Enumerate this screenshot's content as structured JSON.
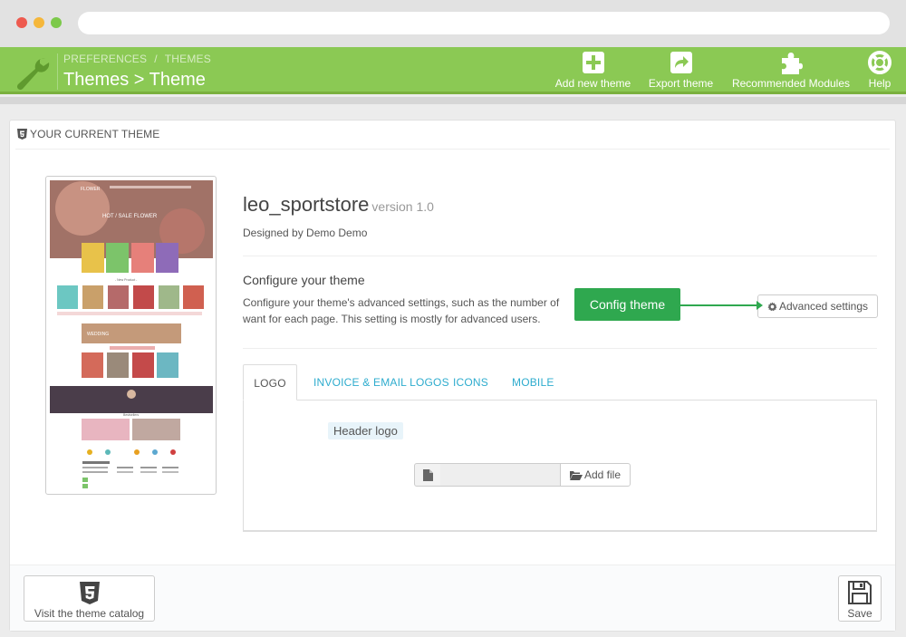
{
  "header": {
    "breadcrumb": [
      "PREFERENCES",
      "THEMES"
    ],
    "breadcrumb_sep": "/",
    "title": "Themes > Theme",
    "toolbar": [
      {
        "label": "Add new theme",
        "icon": "plus-square-icon"
      },
      {
        "label": "Export theme",
        "icon": "export-icon"
      },
      {
        "label": "Recommended Modules",
        "icon": "puzzle-icon"
      },
      {
        "label": "Help",
        "icon": "lifebuoy-icon"
      }
    ]
  },
  "panel": {
    "heading": "YOUR CURRENT THEME",
    "heading_icon": "html5-icon"
  },
  "theme": {
    "name": "leo_sportstore",
    "version": "version 1.0",
    "designed_by": "Designed by Demo Demo",
    "preview": {
      "logo": "FLOWER",
      "banner": "HOT / SALE FLOWER",
      "section_1": "- New Product -",
      "section_2": "WEDDING",
      "section_3": "Bestsellers"
    }
  },
  "configure": {
    "title": "Configure your theme",
    "description_line1": "Configure your theme's advanced settings, such as the number of",
    "description_line2": "want for each page. This setting is mostly for advanced users.",
    "callout": "Config theme",
    "advanced_button": "Advanced settings"
  },
  "tabs": [
    {
      "label": "LOGO",
      "active": true
    },
    {
      "label": "INVOICE & EMAIL LOGOS",
      "active": false
    },
    {
      "label": "ICONS",
      "active": false
    },
    {
      "label": "MOBILE",
      "active": false
    }
  ],
  "logo_tab": {
    "header_logo_label": "Header logo",
    "add_file_button": "Add file",
    "file_value": ""
  },
  "footer": {
    "catalog_button": "Visit the theme catalog",
    "save_button": "Save"
  },
  "colors": {
    "header_green": "#8bc954",
    "callout_green": "#2fa84f",
    "tab_link": "#2eacce"
  }
}
